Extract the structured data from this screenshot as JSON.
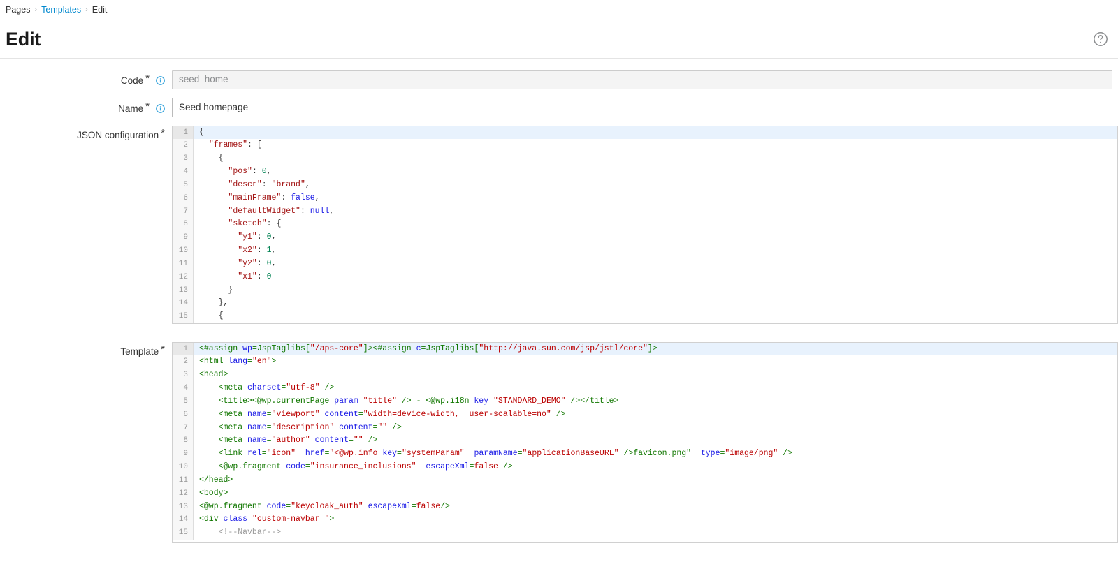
{
  "breadcrumb": {
    "items": [
      {
        "label": "Pages",
        "link": false
      },
      {
        "label": "Templates",
        "link": true
      },
      {
        "label": "Edit",
        "link": false
      }
    ],
    "separator": "›"
  },
  "header": {
    "title": "Edit",
    "help_icon": "help-circle-icon"
  },
  "form": {
    "code": {
      "label": "Code",
      "required_marker": "*",
      "info_icon": "info-circle-icon",
      "value": "seed_home",
      "disabled": true
    },
    "name": {
      "label": "Name",
      "required_marker": "*",
      "info_icon": "info-circle-icon",
      "value": "Seed homepage",
      "disabled": false
    },
    "json_configuration": {
      "label": "JSON configuration",
      "required_marker": "*",
      "active_line": 1,
      "lines": [
        {
          "n": 1,
          "tokens": [
            {
              "t": "punct",
              "v": "{"
            }
          ]
        },
        {
          "n": 2,
          "tokens": [
            {
              "t": "plain",
              "v": "  "
            },
            {
              "t": "key",
              "v": "\"frames\""
            },
            {
              "t": "punct",
              "v": ": ["
            }
          ]
        },
        {
          "n": 3,
          "tokens": [
            {
              "t": "plain",
              "v": "    "
            },
            {
              "t": "punct",
              "v": "{"
            }
          ]
        },
        {
          "n": 4,
          "tokens": [
            {
              "t": "plain",
              "v": "      "
            },
            {
              "t": "key",
              "v": "\"pos\""
            },
            {
              "t": "punct",
              "v": ": "
            },
            {
              "t": "num",
              "v": "0"
            },
            {
              "t": "punct",
              "v": ","
            }
          ]
        },
        {
          "n": 5,
          "tokens": [
            {
              "t": "plain",
              "v": "      "
            },
            {
              "t": "key",
              "v": "\"descr\""
            },
            {
              "t": "punct",
              "v": ": "
            },
            {
              "t": "str",
              "v": "\"brand\""
            },
            {
              "t": "punct",
              "v": ","
            }
          ]
        },
        {
          "n": 6,
          "tokens": [
            {
              "t": "plain",
              "v": "      "
            },
            {
              "t": "key",
              "v": "\"mainFrame\""
            },
            {
              "t": "punct",
              "v": ": "
            },
            {
              "t": "lit",
              "v": "false"
            },
            {
              "t": "punct",
              "v": ","
            }
          ]
        },
        {
          "n": 7,
          "tokens": [
            {
              "t": "plain",
              "v": "      "
            },
            {
              "t": "key",
              "v": "\"defaultWidget\""
            },
            {
              "t": "punct",
              "v": ": "
            },
            {
              "t": "lit",
              "v": "null"
            },
            {
              "t": "punct",
              "v": ","
            }
          ]
        },
        {
          "n": 8,
          "tokens": [
            {
              "t": "plain",
              "v": "      "
            },
            {
              "t": "key",
              "v": "\"sketch\""
            },
            {
              "t": "punct",
              "v": ": {"
            }
          ]
        },
        {
          "n": 9,
          "tokens": [
            {
              "t": "plain",
              "v": "        "
            },
            {
              "t": "key",
              "v": "\"y1\""
            },
            {
              "t": "punct",
              "v": ": "
            },
            {
              "t": "num",
              "v": "0"
            },
            {
              "t": "punct",
              "v": ","
            }
          ]
        },
        {
          "n": 10,
          "tokens": [
            {
              "t": "plain",
              "v": "        "
            },
            {
              "t": "key",
              "v": "\"x2\""
            },
            {
              "t": "punct",
              "v": ": "
            },
            {
              "t": "num",
              "v": "1"
            },
            {
              "t": "punct",
              "v": ","
            }
          ]
        },
        {
          "n": 11,
          "tokens": [
            {
              "t": "plain",
              "v": "        "
            },
            {
              "t": "key",
              "v": "\"y2\""
            },
            {
              "t": "punct",
              "v": ": "
            },
            {
              "t": "num",
              "v": "0"
            },
            {
              "t": "punct",
              "v": ","
            }
          ]
        },
        {
          "n": 12,
          "tokens": [
            {
              "t": "plain",
              "v": "        "
            },
            {
              "t": "key",
              "v": "\"x1\""
            },
            {
              "t": "punct",
              "v": ": "
            },
            {
              "t": "num",
              "v": "0"
            }
          ]
        },
        {
          "n": 13,
          "tokens": [
            {
              "t": "plain",
              "v": "      "
            },
            {
              "t": "punct",
              "v": "}"
            }
          ]
        },
        {
          "n": 14,
          "tokens": [
            {
              "t": "plain",
              "v": "    "
            },
            {
              "t": "punct",
              "v": "},"
            }
          ]
        },
        {
          "n": 15,
          "tokens": [
            {
              "t": "plain",
              "v": "    "
            },
            {
              "t": "punct",
              "v": "{"
            }
          ]
        }
      ]
    },
    "template": {
      "label": "Template",
      "required_marker": "*",
      "active_line": 1,
      "lines": [
        {
          "n": 1,
          "tokens": [
            {
              "t": "tag",
              "v": "<#assign "
            },
            {
              "t": "attr",
              "v": "wp"
            },
            {
              "t": "tag",
              "v": "=JspTaglibs["
            },
            {
              "t": "val",
              "v": "\"/aps-core\""
            },
            {
              "t": "tag",
              "v": "]><#assign "
            },
            {
              "t": "attr",
              "v": "c"
            },
            {
              "t": "tag",
              "v": "=JspTaglibs["
            },
            {
              "t": "val",
              "v": "\"http://java.sun.com/jsp/jstl/core\""
            },
            {
              "t": "tag",
              "v": "]>"
            }
          ]
        },
        {
          "n": 2,
          "tokens": [
            {
              "t": "tag",
              "v": "<html "
            },
            {
              "t": "attr",
              "v": "lang"
            },
            {
              "t": "tag",
              "v": "="
            },
            {
              "t": "val",
              "v": "\"en\""
            },
            {
              "t": "tag",
              "v": ">"
            }
          ]
        },
        {
          "n": 3,
          "tokens": [
            {
              "t": "tag",
              "v": "<head>"
            }
          ]
        },
        {
          "n": 4,
          "tokens": [
            {
              "t": "plain",
              "v": "    "
            },
            {
              "t": "tag",
              "v": "<meta "
            },
            {
              "t": "attr",
              "v": "charset"
            },
            {
              "t": "tag",
              "v": "="
            },
            {
              "t": "val",
              "v": "\"utf-8\""
            },
            {
              "t": "tag",
              "v": " />"
            }
          ]
        },
        {
          "n": 5,
          "tokens": [
            {
              "t": "plain",
              "v": "    "
            },
            {
              "t": "tag",
              "v": "<title><@wp.currentPage "
            },
            {
              "t": "attr",
              "v": "param"
            },
            {
              "t": "tag",
              "v": "="
            },
            {
              "t": "val",
              "v": "\"title\""
            },
            {
              "t": "tag",
              "v": " /> - <@wp.i18n "
            },
            {
              "t": "attr",
              "v": "key"
            },
            {
              "t": "tag",
              "v": "="
            },
            {
              "t": "val",
              "v": "\"STANDARD_DEMO\""
            },
            {
              "t": "tag",
              "v": " /></title>"
            }
          ]
        },
        {
          "n": 6,
          "tokens": [
            {
              "t": "plain",
              "v": "    "
            },
            {
              "t": "tag",
              "v": "<meta "
            },
            {
              "t": "attr",
              "v": "name"
            },
            {
              "t": "tag",
              "v": "="
            },
            {
              "t": "val",
              "v": "\"viewport\""
            },
            {
              "t": "tag",
              "v": " "
            },
            {
              "t": "attr",
              "v": "content"
            },
            {
              "t": "tag",
              "v": "="
            },
            {
              "t": "val",
              "v": "\"width=device-width,  user-scalable=no\""
            },
            {
              "t": "tag",
              "v": " />"
            }
          ]
        },
        {
          "n": 7,
          "tokens": [
            {
              "t": "plain",
              "v": "    "
            },
            {
              "t": "tag",
              "v": "<meta "
            },
            {
              "t": "attr",
              "v": "name"
            },
            {
              "t": "tag",
              "v": "="
            },
            {
              "t": "val",
              "v": "\"description\""
            },
            {
              "t": "tag",
              "v": " "
            },
            {
              "t": "attr",
              "v": "content"
            },
            {
              "t": "tag",
              "v": "="
            },
            {
              "t": "val",
              "v": "\"\""
            },
            {
              "t": "tag",
              "v": " />"
            }
          ]
        },
        {
          "n": 8,
          "tokens": [
            {
              "t": "plain",
              "v": "    "
            },
            {
              "t": "tag",
              "v": "<meta "
            },
            {
              "t": "attr",
              "v": "name"
            },
            {
              "t": "tag",
              "v": "="
            },
            {
              "t": "val",
              "v": "\"author\""
            },
            {
              "t": "tag",
              "v": " "
            },
            {
              "t": "attr",
              "v": "content"
            },
            {
              "t": "tag",
              "v": "="
            },
            {
              "t": "val",
              "v": "\"\""
            },
            {
              "t": "tag",
              "v": " />"
            }
          ]
        },
        {
          "n": 9,
          "tokens": [
            {
              "t": "plain",
              "v": "    "
            },
            {
              "t": "tag",
              "v": "<link "
            },
            {
              "t": "attr",
              "v": "rel"
            },
            {
              "t": "tag",
              "v": "="
            },
            {
              "t": "val",
              "v": "\"icon\""
            },
            {
              "t": "tag",
              "v": "  "
            },
            {
              "t": "attr",
              "v": "href"
            },
            {
              "t": "tag",
              "v": "="
            },
            {
              "t": "val",
              "v": "\"<@wp.info "
            },
            {
              "t": "attr",
              "v": "key"
            },
            {
              "t": "tag",
              "v": "="
            },
            {
              "t": "val",
              "v": "\"systemParam\""
            },
            {
              "t": "tag",
              "v": "  "
            },
            {
              "t": "attr",
              "v": "paramName"
            },
            {
              "t": "tag",
              "v": "="
            },
            {
              "t": "val",
              "v": "\"applicationBaseURL\""
            },
            {
              "t": "tag",
              "v": " />favicon.png\"  "
            },
            {
              "t": "attr",
              "v": "type"
            },
            {
              "t": "tag",
              "v": "="
            },
            {
              "t": "val",
              "v": "\"image/png\""
            },
            {
              "t": "tag",
              "v": " />"
            }
          ]
        },
        {
          "n": 10,
          "tokens": [
            {
              "t": "plain",
              "v": "    "
            },
            {
              "t": "tag",
              "v": "<@wp.fragment "
            },
            {
              "t": "attr",
              "v": "code"
            },
            {
              "t": "tag",
              "v": "="
            },
            {
              "t": "val",
              "v": "\"insurance_inclusions\""
            },
            {
              "t": "tag",
              "v": "  "
            },
            {
              "t": "attr",
              "v": "escapeXml"
            },
            {
              "t": "tag",
              "v": "="
            },
            {
              "t": "val",
              "v": "false"
            },
            {
              "t": "tag",
              "v": " />"
            }
          ]
        },
        {
          "n": 11,
          "tokens": [
            {
              "t": "tag",
              "v": "</head>"
            }
          ]
        },
        {
          "n": 12,
          "tokens": [
            {
              "t": "tag",
              "v": "<body>"
            }
          ]
        },
        {
          "n": 13,
          "tokens": [
            {
              "t": "tag",
              "v": "<@wp.fragment "
            },
            {
              "t": "attr",
              "v": "code"
            },
            {
              "t": "tag",
              "v": "="
            },
            {
              "t": "val",
              "v": "\"keycloak_auth\""
            },
            {
              "t": "tag",
              "v": " "
            },
            {
              "t": "attr",
              "v": "escapeXml"
            },
            {
              "t": "tag",
              "v": "="
            },
            {
              "t": "val",
              "v": "false"
            },
            {
              "t": "tag",
              "v": "/>"
            }
          ]
        },
        {
          "n": 14,
          "tokens": [
            {
              "t": "tag",
              "v": "<div "
            },
            {
              "t": "attr",
              "v": "class"
            },
            {
              "t": "tag",
              "v": "="
            },
            {
              "t": "val",
              "v": "\"custom-navbar \""
            },
            {
              "t": "tag",
              "v": ">"
            }
          ]
        },
        {
          "n": 15,
          "tokens": [
            {
              "t": "plain",
              "v": "    "
            },
            {
              "t": "comment",
              "v": "<!--Navbar-->"
            }
          ]
        }
      ]
    }
  }
}
